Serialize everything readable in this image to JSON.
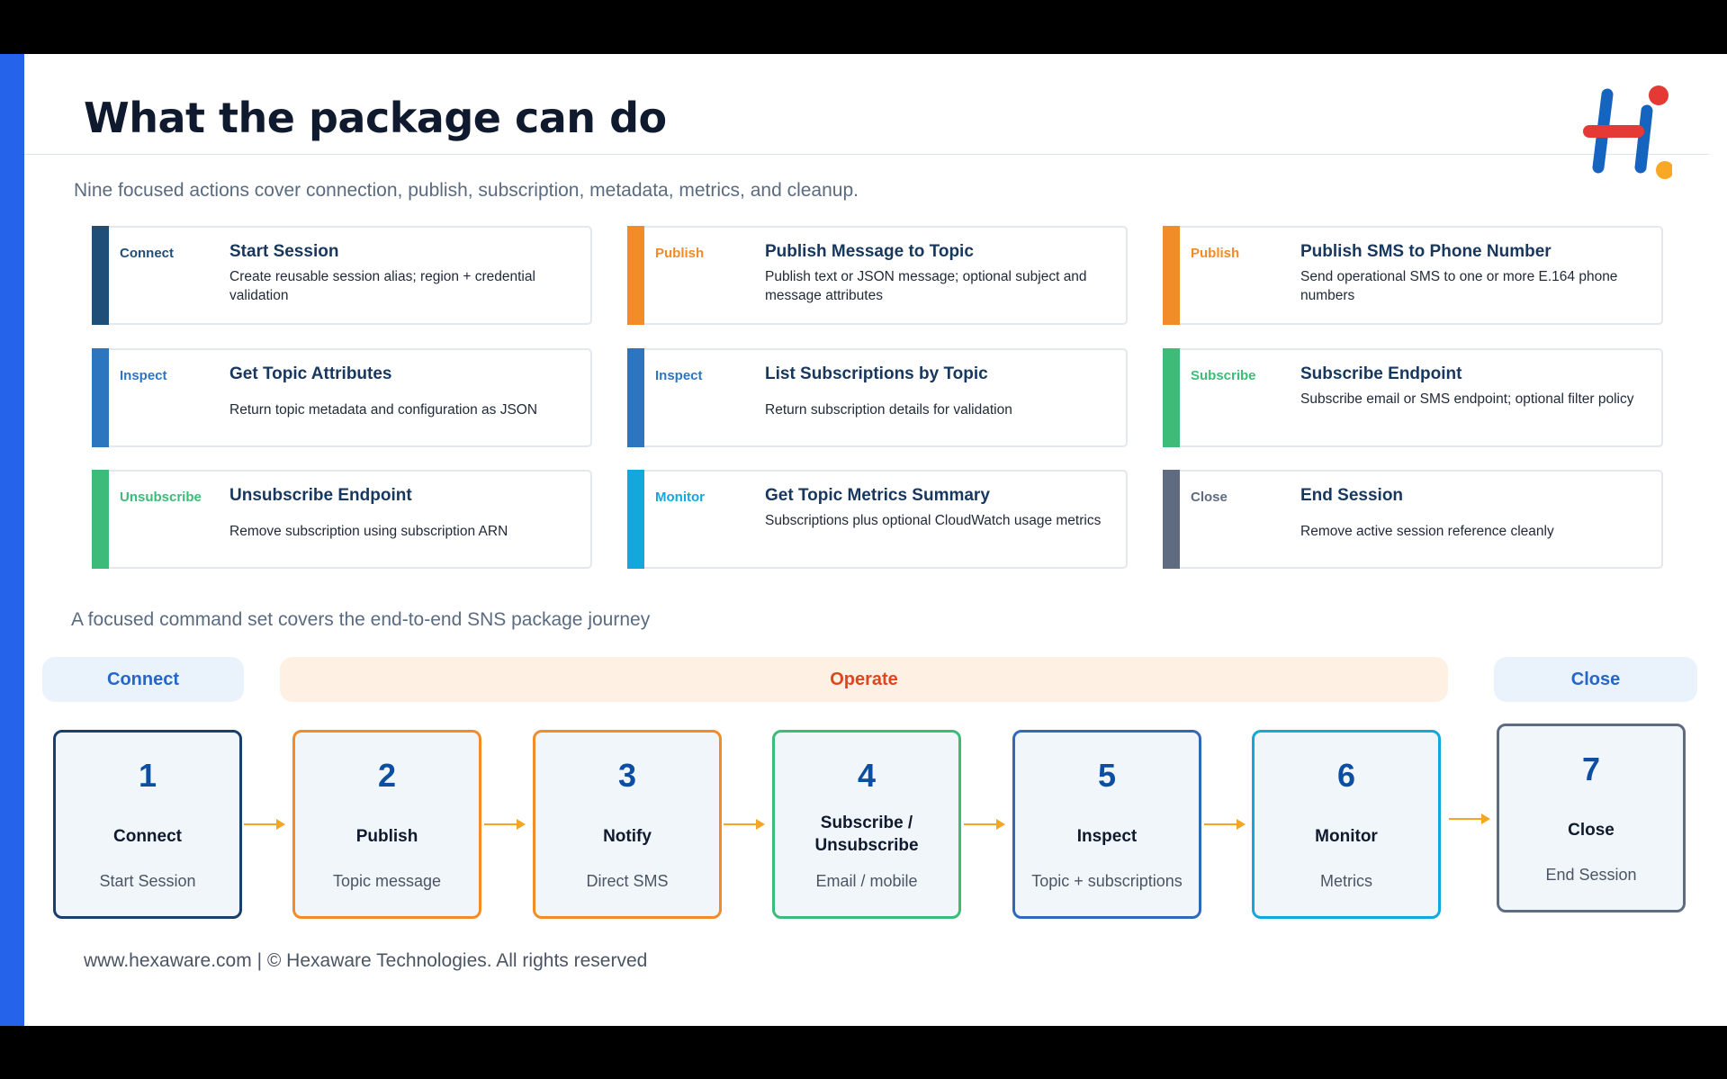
{
  "title": "What the package can do",
  "subtitle": "Nine focused actions cover connection, publish, subscription, metadata, metrics, and cleanup.",
  "cards": [
    {
      "tag": "Connect",
      "title": "Start Session",
      "desc": "Create reusable session alias; region + credential validation",
      "color": "#1f4e79"
    },
    {
      "tag": "Publish",
      "title": "Publish Message to Topic",
      "desc": "Publish text or JSON message; optional subject and message attributes",
      "color": "#f28c28"
    },
    {
      "tag": "Publish",
      "title": "Publish SMS to Phone Number",
      "desc": "Send operational SMS to one or more E.164 phone numbers",
      "color": "#f28c28"
    },
    {
      "tag": "Inspect",
      "title": "Get Topic Attributes",
      "desc": "Return topic metadata and configuration as JSON",
      "color": "#2e75c0"
    },
    {
      "tag": "Inspect",
      "title": "List Subscriptions by Topic",
      "desc": "Return subscription details for validation",
      "color": "#2e75c0"
    },
    {
      "tag": "Subscribe",
      "title": "Subscribe Endpoint",
      "desc": "Subscribe email or SMS endpoint; optional filter policy",
      "color": "#3dbb78"
    },
    {
      "tag": "Unsubscribe",
      "title": "Unsubscribe Endpoint",
      "desc": "Remove subscription using subscription ARN",
      "color": "#3dbb78"
    },
    {
      "tag": "Monitor",
      "title": "Get Topic Metrics Summary",
      "desc": "Subscriptions plus optional CloudWatch usage metrics",
      "color": "#12a8dc"
    },
    {
      "tag": "Close",
      "title": "End Session",
      "desc": "Remove active session reference cleanly",
      "color": "#5f6b80"
    }
  ],
  "journey_caption": "A focused command set covers the end-to-end SNS package journey",
  "phases": [
    {
      "label": "Connect",
      "color": "#2467c8",
      "bg": "#eaf2fc"
    },
    {
      "label": "Operate",
      "color": "#e0461c",
      "bg": "#fef1e4"
    },
    {
      "label": "Close",
      "color": "#2467c8",
      "bg": "#eaf2fc"
    }
  ],
  "steps": [
    {
      "num": "1",
      "label": "Connect",
      "sub": "Start Session",
      "border": "#1a3f6d"
    },
    {
      "num": "2",
      "label": "Publish",
      "sub": "Topic message",
      "border": "#f28c28"
    },
    {
      "num": "3",
      "label": "Notify",
      "sub": "Direct SMS",
      "border": "#f28c28"
    },
    {
      "num": "4",
      "label": "Subscribe / Unsubscribe",
      "sub": "Email / mobile",
      "border": "#3dbb78"
    },
    {
      "num": "5",
      "label": "Inspect",
      "sub": "Topic + subscriptions",
      "border": "#2e6ab8"
    },
    {
      "num": "6",
      "label": "Monitor",
      "sub": "Metrics",
      "border": "#12a8dc"
    },
    {
      "num": "7",
      "label": "Close",
      "sub": "End Session",
      "border": "#5f6b80"
    }
  ],
  "arrow_color": "#f5a623",
  "footer": "www.hexaware.com | © Hexaware Technologies. All rights reserved",
  "logo": {
    "icon": "hexaware-logo-icon"
  }
}
